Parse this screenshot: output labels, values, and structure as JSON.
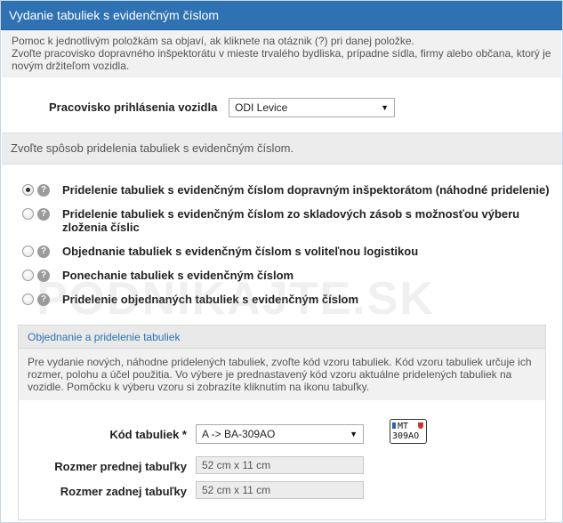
{
  "panel": {
    "title": "Vydanie tabuliek s evidenčným číslom",
    "help_line1": "Pomoc k jednotlivým položkám sa objaví, ak kliknete na otáznik (?) pri danej položke.",
    "help_line2": "Zvoľte pracovisko dopravného inšpektorátu v mieste trvalého bydliska, prípadne sídla, firmy alebo občana, ktorý je novým držiteľom vozidla."
  },
  "office": {
    "label": "Pracovisko prihlásenia vozidla",
    "selected": "ODI Levice",
    "arrow": "▼"
  },
  "method_section": {
    "title": "Zvoľte spôsob pridelenia tabuliek s evidenčným číslom.",
    "help_glyph": "?",
    "options": [
      {
        "label": "Pridelenie tabuliek s evidenčným číslom dopravným inšpektorátom (náhodné pridelenie)",
        "checked": true
      },
      {
        "label": "Pridelenie tabuliek s evidenčným číslom zo skladových zásob s možnosťou výberu zloženia číslic",
        "checked": false
      },
      {
        "label": "Objednanie tabuliek s evidenčným číslom s voliteľnou logistikou",
        "checked": false
      },
      {
        "label": "Ponechanie tabuliek s evidenčným číslom",
        "checked": false
      },
      {
        "label": "Pridelenie objednaných tabuliek s evidenčným číslom",
        "checked": false
      }
    ]
  },
  "order_panel": {
    "title": "Objednanie a pridelenie tabuliek",
    "help": "Pre vydanie nových, náhodne pridelených tabuliek, zvoľte kód vzoru tabuliek. Kód vzoru tabuliek určuje ich rozmer, polohu a účel použitia. Vo výbere je prednastavený kód vzoru aktuálne pridelených tabuliek na vozidle. Pomôcku k výberu vzoru si zobrazíte kliknutím na ikonu tabuľky.",
    "code_label": "Kód tabuliek *",
    "code_selected": "A -> BA-309AO",
    "code_arrow": "▼",
    "plate_line1": "MT",
    "plate_line2": "309AO",
    "front_label": "Rozmer prednej tabuľky",
    "front_value": "52 cm x 11 cm",
    "rear_label": "Rozmer zadnej tabuľky",
    "rear_value": "52 cm x 11 cm"
  },
  "watermark": "PODNIKAJTE.SK"
}
